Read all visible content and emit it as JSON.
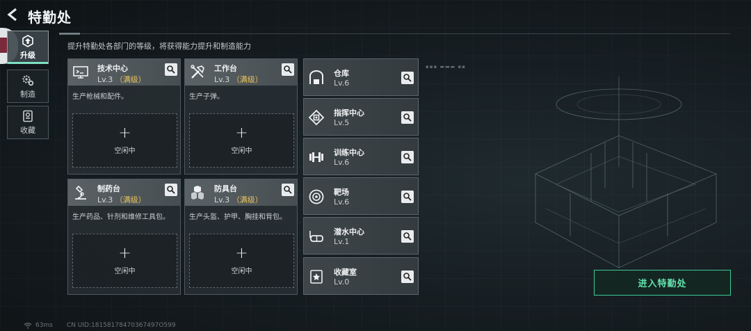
{
  "header": {
    "title": "特勤处",
    "subtitle": "提升特勤处各部门的等级，将获得能力提升和制造能力"
  },
  "nav": [
    {
      "label": "升级",
      "icon": "upgrade-icon",
      "active": true
    },
    {
      "label": "制造",
      "icon": "gear-icon",
      "active": false
    },
    {
      "label": "收藏",
      "icon": "collection-icon",
      "active": false
    }
  ],
  "departments": [
    {
      "name": "技术中心",
      "level": "Lv.3",
      "max": "（满级）",
      "desc": "生产枪械和配件。",
      "icon": "monitor-icon",
      "slot_label": "空闲中"
    },
    {
      "name": "工作台",
      "level": "Lv.3",
      "max": "（满级）",
      "desc": "生产子弹。",
      "icon": "tools-icon",
      "slot_label": "空闲中"
    },
    {
      "name": "制药台",
      "level": "Lv.3",
      "max": "（满级）",
      "desc": "生产药品、针剂和维修工具包。",
      "icon": "microscope-icon",
      "slot_label": "空闲中"
    },
    {
      "name": "防具台",
      "level": "Lv.3",
      "max": "（满级）",
      "desc": "生产头盔、护甲、胸挂和背包。",
      "icon": "armor-icon",
      "slot_label": "空闲中"
    }
  ],
  "side_departments": [
    {
      "name": "仓库",
      "level": "Lv.6",
      "icon": "warehouse-icon"
    },
    {
      "name": "指挥中心",
      "level": "Lv.5",
      "icon": "chip-icon"
    },
    {
      "name": "训练中心",
      "level": "Lv.6",
      "icon": "dumbbell-icon"
    },
    {
      "name": "靶场",
      "level": "Lv.6",
      "icon": "target-icon"
    },
    {
      "name": "潜水中心",
      "level": "Lv.1",
      "icon": "diving-mask-icon"
    },
    {
      "name": "收藏室",
      "level": "Lv.0",
      "icon": "trophy-icon"
    }
  ],
  "enter_button": "进入特勤处",
  "footer": {
    "ping": "63ms",
    "uid": "CN UID:18158178470367497O599"
  },
  "colors": {
    "accent_green": "#3fcb96",
    "max_level_gold": "#e8c25a"
  }
}
